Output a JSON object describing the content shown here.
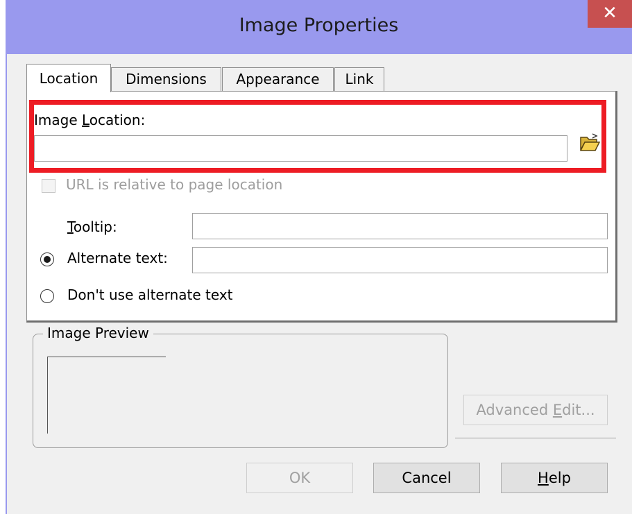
{
  "window": {
    "title": "Image Properties",
    "close_glyph": "✕",
    "titlebar_color": "#9999ee",
    "close_color": "#c75050"
  },
  "tabs": [
    {
      "label": "Location",
      "active": true
    },
    {
      "label": "Dimensions",
      "active": false
    },
    {
      "label": "Appearance",
      "active": false
    },
    {
      "label": "Link",
      "active": false
    }
  ],
  "location": {
    "image_location_label_pre": "Image ",
    "image_location_label_u": "L",
    "image_location_label_post": "ocation:",
    "image_location_value": "",
    "browse_icon": "folder-open-icon",
    "highlight_color": "#ed1c24",
    "relative_checkbox_label": "URL is relative to page location",
    "relative_checkbox_checked": false,
    "relative_checkbox_enabled": false,
    "tooltip_label_u": "T",
    "tooltip_label_post": "ooltip:",
    "tooltip_value": "",
    "alt_radio_label": "Alternate text:",
    "alt_radio_selected": true,
    "alt_value": "",
    "no_alt_radio_label": "Don't use alternate text",
    "no_alt_radio_selected": false
  },
  "preview": {
    "group_label": "Image Preview"
  },
  "buttons": {
    "advanced_edit_pre": "Advanced ",
    "advanced_edit_u": "E",
    "advanced_edit_post": "dit...",
    "ok": "OK",
    "cancel": "Cancel",
    "help_u": "H",
    "help_post": "elp"
  }
}
